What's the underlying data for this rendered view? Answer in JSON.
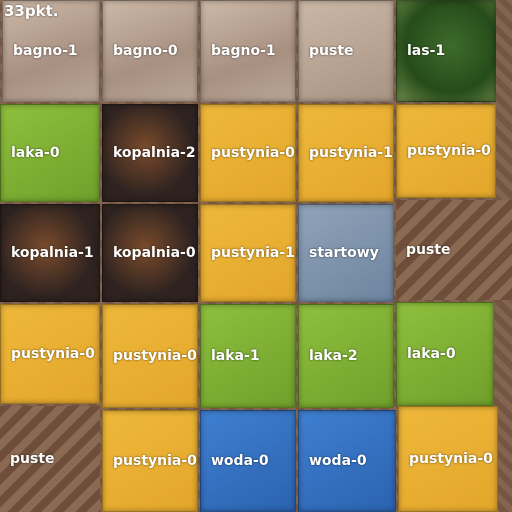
{
  "score": "33pkt.",
  "rows": [
    [
      {
        "type": "bagno",
        "label": "bagno-1"
      },
      {
        "type": "bagno",
        "label": "bagno-0"
      },
      {
        "type": "bagno",
        "label": "bagno-1"
      },
      {
        "type": "puste-top",
        "label": "puste"
      },
      {
        "type": "las",
        "label": "las-1"
      }
    ],
    [
      {
        "type": "laka",
        "label": "laka-0"
      },
      {
        "type": "kopalnia",
        "label": "kopalnia-2"
      },
      {
        "type": "pustynia",
        "label": "pustynia-0"
      },
      {
        "type": "pustynia",
        "label": "pustynia-1"
      },
      {
        "type": "pustynia",
        "label": "pustynia-0"
      }
    ],
    [
      {
        "type": "kopalnia",
        "label": "kopalnia-1"
      },
      {
        "type": "kopalnia",
        "label": "kopalnia-0"
      },
      {
        "type": "pustynia",
        "label": "pustynia-1"
      },
      {
        "type": "start",
        "label": "startowy"
      },
      {
        "type": "puste",
        "label": "puste"
      }
    ],
    [
      {
        "type": "pustynia",
        "label": "pustynia-0"
      },
      {
        "type": "pustynia",
        "label": "pustynia-0"
      },
      {
        "type": "laka",
        "label": "laka-1"
      },
      {
        "type": "laka",
        "label": "laka-2"
      },
      {
        "type": "laka",
        "label": "laka-0"
      }
    ],
    [
      {
        "type": "puste",
        "label": "puste"
      },
      {
        "type": "pustynia",
        "label": "pustynia-0"
      },
      {
        "type": "woda",
        "label": "woda-0"
      },
      {
        "type": "woda",
        "label": "woda-0"
      },
      {
        "type": "pustynia",
        "label": "pustynia-0"
      }
    ]
  ]
}
